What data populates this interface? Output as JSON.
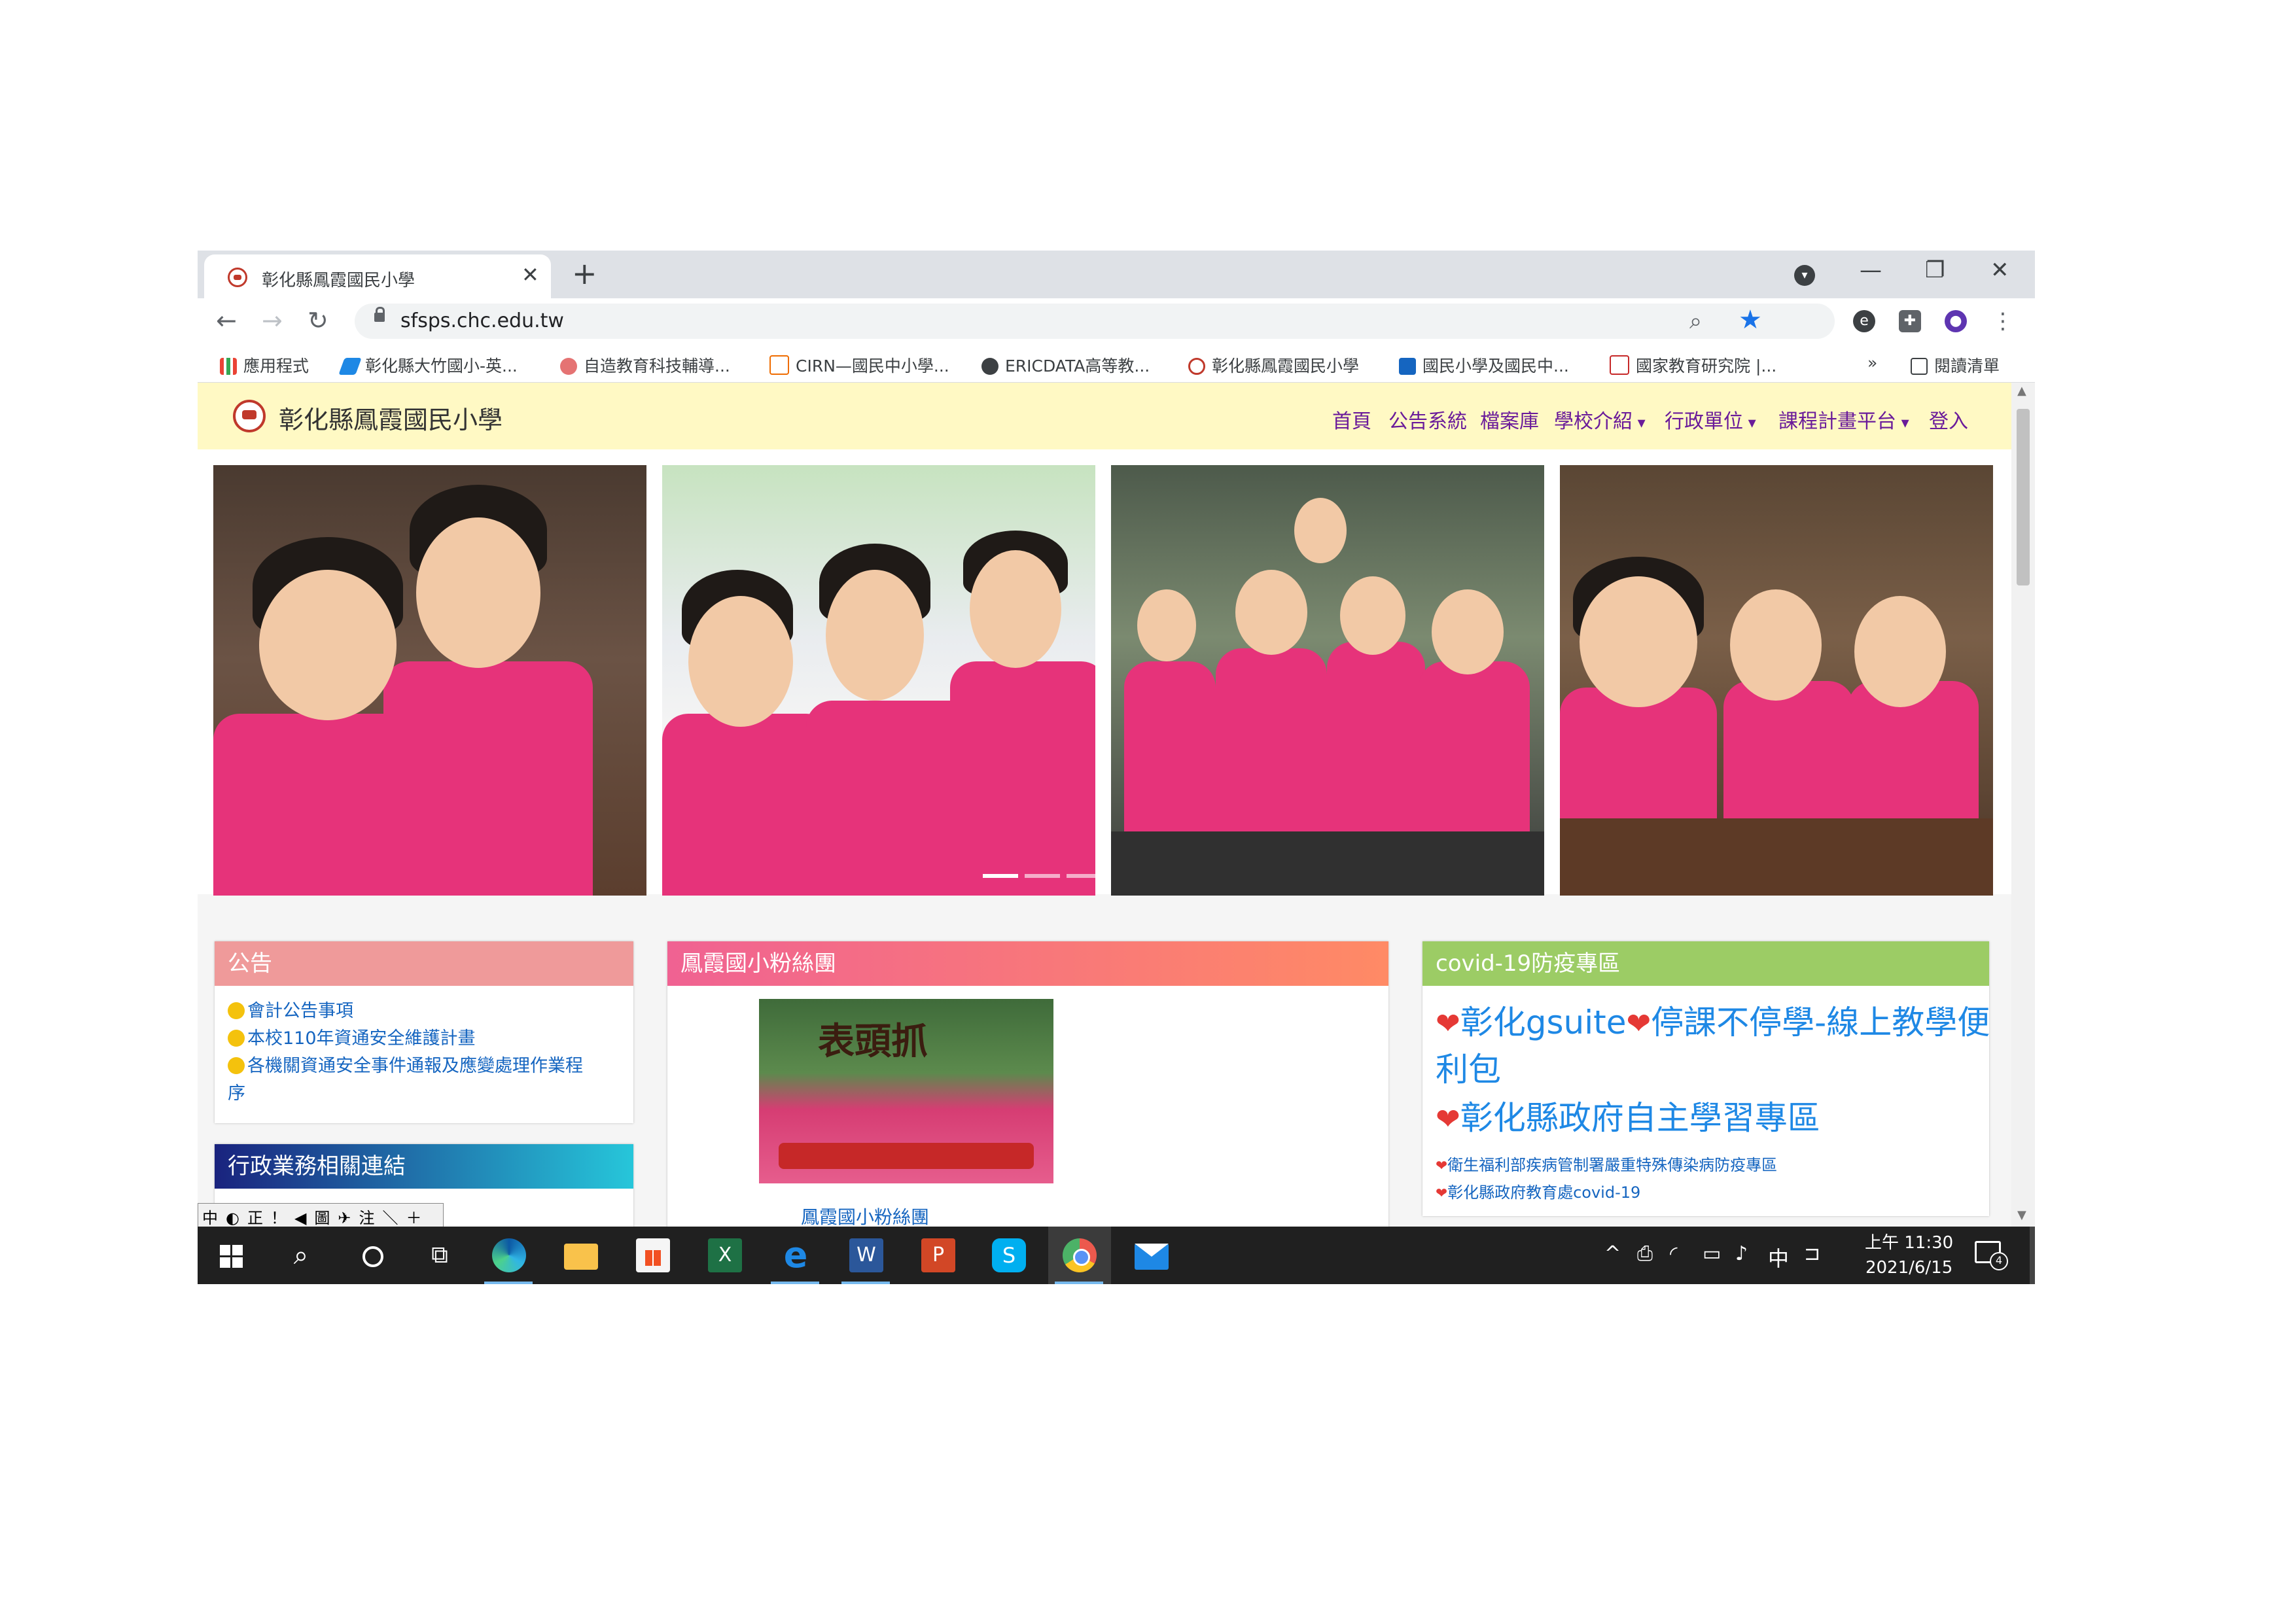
{
  "browser": {
    "tab_title": "彰化縣鳳霞國民小學",
    "tab_close": "✕",
    "new_tab": "+",
    "url": "sfsps.chc.edu.tw",
    "minimize": "—",
    "restore": "❐",
    "close": "✕",
    "back": "←",
    "forward": "→",
    "reload": "↻",
    "overflow": "»",
    "reading_list": "閱讀清單",
    "bookmarks": [
      "應用程式",
      "彰化縣大竹國小-英...",
      "自造教育科技輔導...",
      "CIRN—國民中小學...",
      "ERICDATA高等教...",
      "彰化縣鳳霞國民小學",
      "國民小學及國民中...",
      "國家教育研究院 |..."
    ]
  },
  "site": {
    "name": "彰化縣鳳霞國民小學",
    "menu": [
      "首頁",
      "公告系統",
      "檔案庫",
      "學校介紹",
      "行政單位",
      "課程計畫平台",
      "登入"
    ]
  },
  "announcements": {
    "title": "公告",
    "items": [
      "會計公告事項",
      "本校110年資通安全維護計畫",
      "各機關資通安全事件通報及應變處理作業程",
      "序"
    ]
  },
  "admin_links": {
    "title": "行政業務相關連結"
  },
  "fans": {
    "title": "鳳霞國小粉絲團",
    "caption": "鳳霞國小粉絲團",
    "banner": "表頭抓"
  },
  "covid": {
    "title": "covid-19防疫專區",
    "line1a": "彰化gsuite",
    "line1b": "停課不停學-線上教學便",
    "line1c": "利包",
    "line2": "彰化縣政府自主學習專區",
    "line3": "衛生福利部疾病管制署嚴重特殊傳染病防疫專區",
    "line4": "彰化縣政府教育處covid-19"
  },
  "ime": [
    "中",
    "◐",
    "正",
    "！",
    "◀",
    "圖",
    "✈",
    "注",
    "＼",
    "＋"
  ],
  "taskbar": {
    "clock_time": "上午 11:30",
    "clock_date": "2021/6/15",
    "ime_lang": "中",
    "notif_count": "4"
  },
  "colors": {
    "announce_header": "#ef9a9a",
    "fans_header_from": "#f06292",
    "fans_header_to": "#ff8a65",
    "covid_header": "#9ccc65",
    "admin_header_from": "#1a237e",
    "admin_header_to": "#26c6da",
    "site_bar": "#fff9c4",
    "menu_link": "#6a1b9a"
  }
}
